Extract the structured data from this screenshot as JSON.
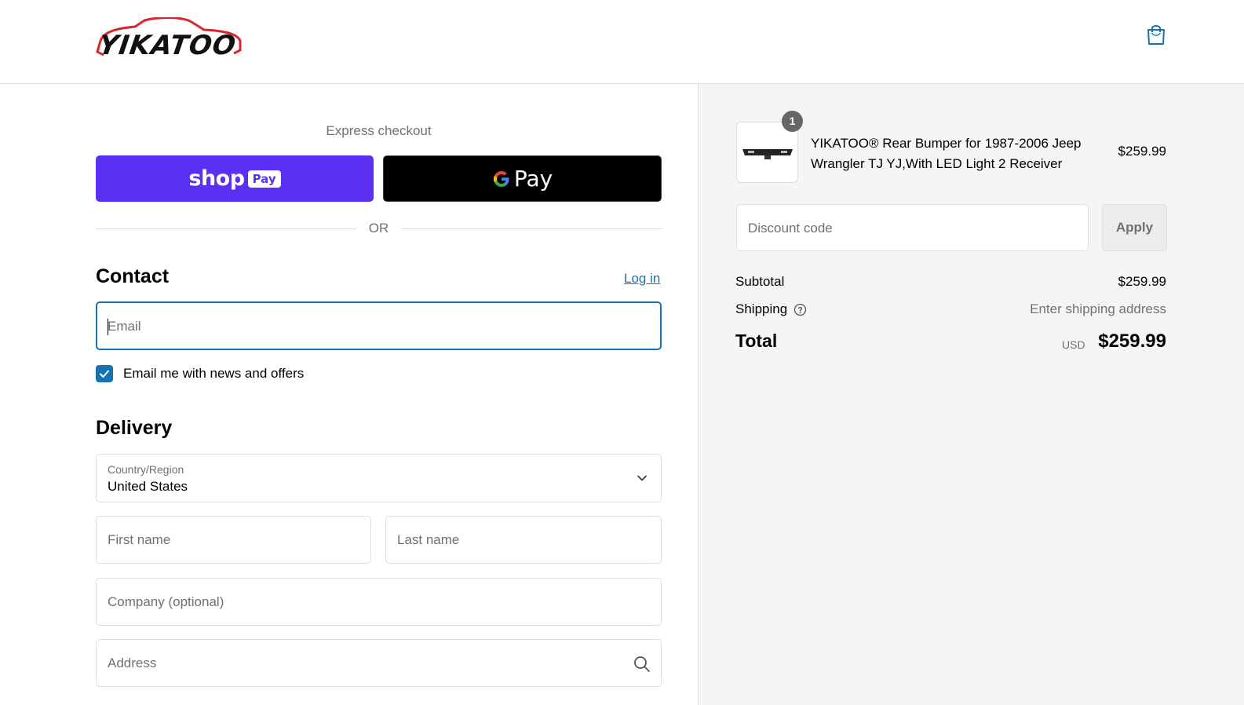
{
  "header": {
    "logo_text": "YIKATOO",
    "cart_icon": "shopping-bag-icon"
  },
  "express": {
    "label": "Express checkout",
    "shop_pay": {
      "word": "shop",
      "badge": "Pay"
    },
    "google_pay": {
      "word": "Pay",
      "icon": "google-g-icon"
    },
    "divider": "OR"
  },
  "contact": {
    "title": "Contact",
    "login_link": "Log in",
    "email_placeholder": "Email",
    "newsletter_label": "Email me with news and offers",
    "newsletter_checked": true
  },
  "delivery": {
    "title": "Delivery",
    "country_label": "Country/Region",
    "country_value": "United States",
    "first_name_placeholder": "First name",
    "last_name_placeholder": "Last name",
    "company_placeholder": "Company (optional)",
    "address_placeholder": "Address"
  },
  "summary": {
    "item": {
      "quantity": "1",
      "title": "YIKATOO® Rear Bumper for 1987-2006 Jeep Wrangler TJ YJ,With LED Light 2 Receiver",
      "price": "$259.99"
    },
    "discount_placeholder": "Discount code",
    "apply_label": "Apply",
    "subtotal_label": "Subtotal",
    "subtotal_value": "$259.99",
    "shipping_label": "Shipping",
    "shipping_value": "Enter shipping address",
    "total_label": "Total",
    "currency": "USD",
    "total_value": "$259.99"
  },
  "colors": {
    "accent": "#1773b0",
    "shop_pay": "#5a31f4",
    "google_pay": "#000000",
    "summary_bg": "#f5f5f5"
  }
}
